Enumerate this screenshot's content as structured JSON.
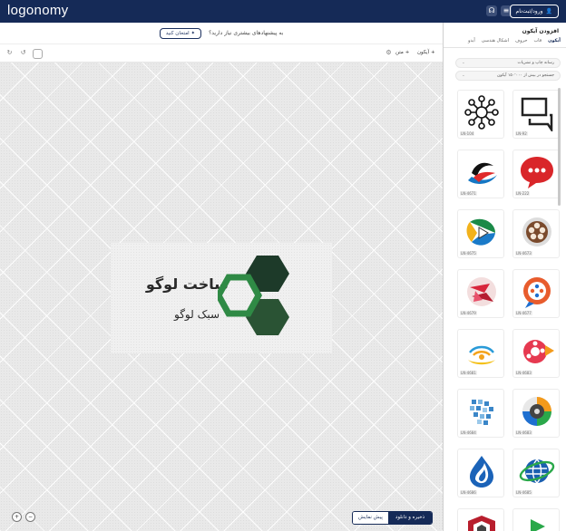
{
  "topbar": {
    "brand": "logonomy",
    "login_label": "ورود/ثبت‌نام",
    "icons": [
      "user-icon",
      "menu-icon",
      "headset-icon"
    ]
  },
  "banner": {
    "question": "به پیشنهادهای بیشتری نیاز دارید؟",
    "button_label": "امتحان کنید"
  },
  "toolbar": {
    "add_icon_label": "آیکون",
    "add_text_label": "متن"
  },
  "logo": {
    "title": "ساخت لوگو",
    "subtitle": "سبک لوگو",
    "colors": {
      "dark_green": "#1e3b2a",
      "mid_green": "#295536",
      "bright_green": "#2f8a45"
    }
  },
  "bottom": {
    "preview_label": "پیش نمایش",
    "save_label": "ذخیره و دانلود"
  },
  "panel": {
    "title": "افزودن آیکون",
    "tabs": [
      "آیکون",
      "قاب",
      "حروف",
      "اشکال هندسی",
      "آیدو"
    ],
    "category_select": "رسانه چاپ و نشریات",
    "search_select": "جستجو در بیش از ۱۵۰٬۰۰۰ آیکون",
    "icons": [
      {
        "label": "LN-92",
        "name": "chat-bubbles-icon"
      },
      {
        "label": "LN-104",
        "name": "network-icon"
      },
      {
        "label": "LN-222",
        "name": "red-chat-icon"
      },
      {
        "label": "LN-4671",
        "name": "swoosh-icon"
      },
      {
        "label": "LN-4673",
        "name": "film-reel-icon"
      },
      {
        "label": "LN-4675",
        "name": "play-triangle-icon"
      },
      {
        "label": "LN-4677",
        "name": "film-bubble-icon"
      },
      {
        "label": "LN-4679",
        "name": "origami-icon"
      },
      {
        "label": "LN-4683",
        "name": "film-play-icon"
      },
      {
        "label": "LN-4681",
        "name": "wifi-ornament-icon"
      },
      {
        "label": "LN-4683",
        "name": "reel-rainbow-icon"
      },
      {
        "label": "LN-4684",
        "name": "pixel-cloud-icon"
      },
      {
        "label": "LN-4685",
        "name": "globe-orbit-icon"
      },
      {
        "label": "LN-4686",
        "name": "flame-drop-icon"
      },
      {
        "label": "",
        "name": "shield-icon"
      },
      {
        "label": "",
        "name": "play-cube-icon"
      }
    ]
  }
}
